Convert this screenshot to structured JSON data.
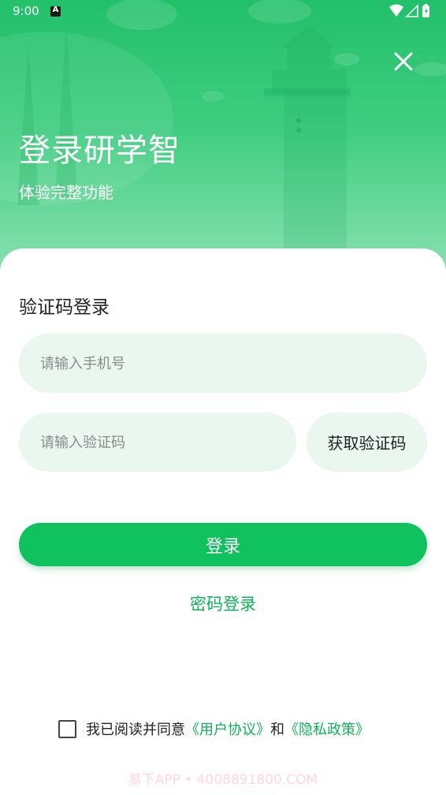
{
  "status_bar": {
    "time": "9:00",
    "notification_icon": "a-badge-icon",
    "wifi_icon": "wifi-icon",
    "signal_icon": "signal-icon",
    "battery_icon": "battery-icon"
  },
  "header": {
    "title": "登录研学智",
    "subtitle": "体验完整功能",
    "close_icon": "close-icon"
  },
  "form": {
    "section_title": "验证码登录",
    "phone_placeholder": "请输入手机号",
    "phone_value": "",
    "code_placeholder": "请输入验证码",
    "code_value": "",
    "get_code_label": "获取验证码",
    "login_label": "登录",
    "password_login_label": "密码登录"
  },
  "agreement": {
    "checked": false,
    "prefix": "我已阅读并同意",
    "user_agreement": "《用户协议》",
    "conjunction": "和",
    "privacy_policy": "《隐私政策》"
  },
  "watermark": "易下APP • 4008891800.COM",
  "colors": {
    "primary": "#10c25e",
    "link": "#10b05a",
    "field_bg": "#e9f7ee",
    "hero_top": "#22c06a",
    "hero_bottom": "#8fe2b4"
  }
}
